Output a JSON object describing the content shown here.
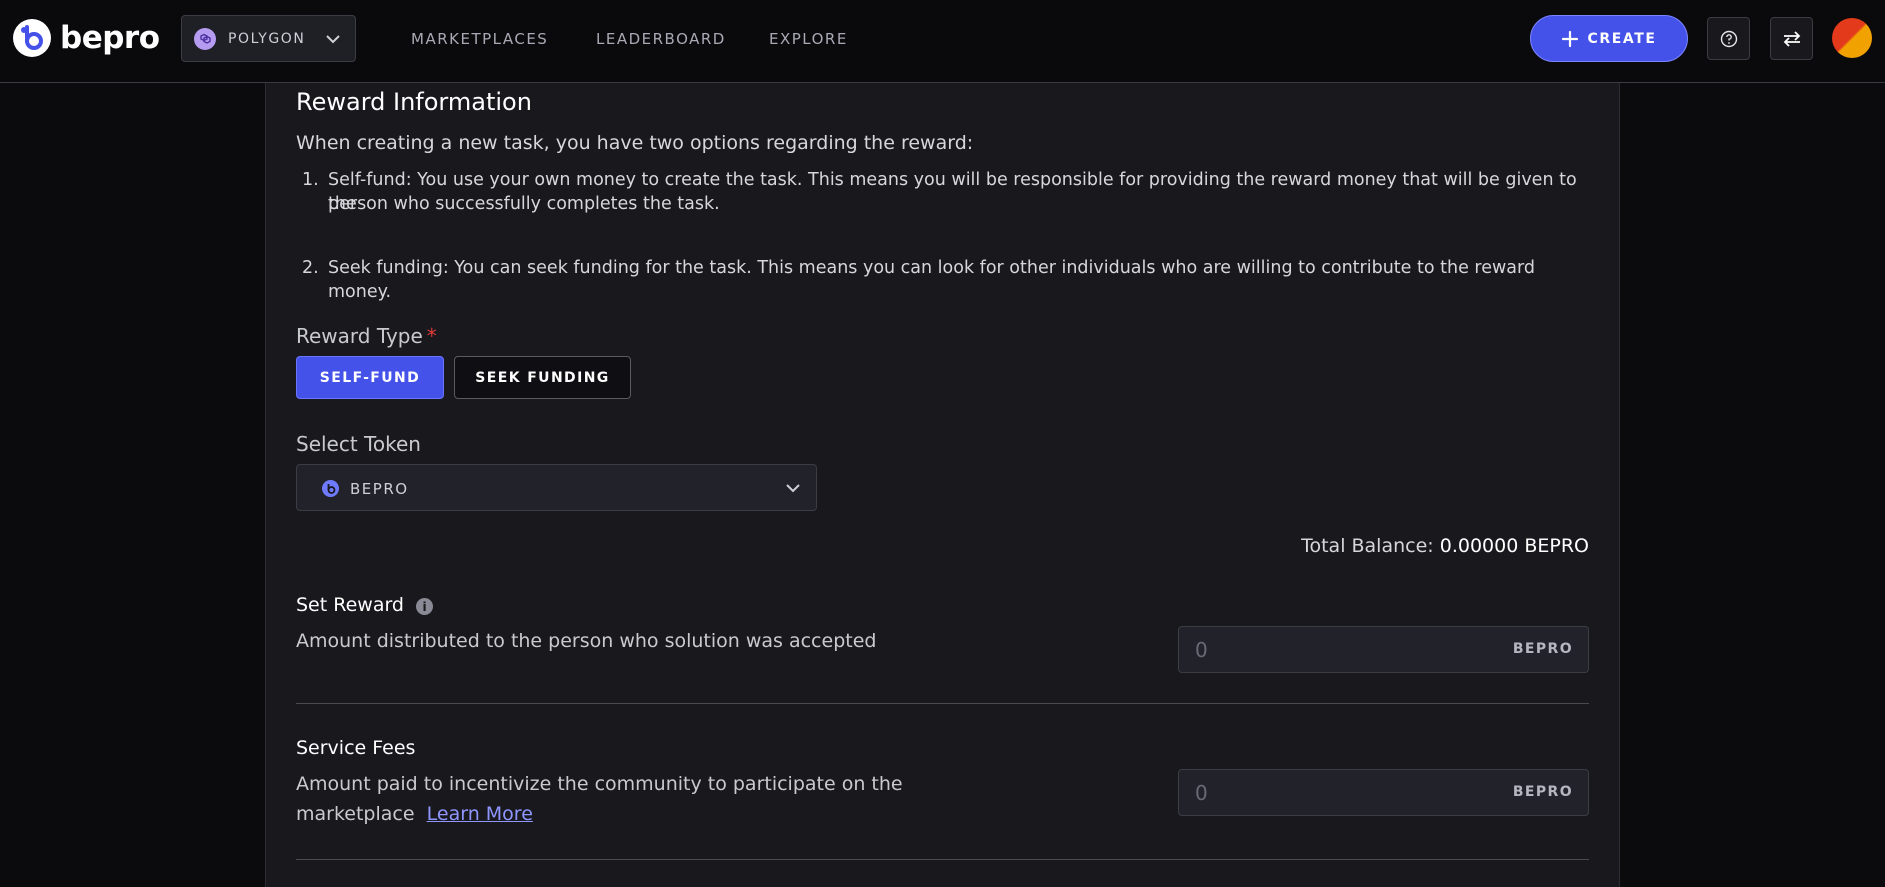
{
  "header": {
    "logo_text": "bepro",
    "network": {
      "label": "POLYGON",
      "icon": "polygon-icon"
    },
    "nav": [
      "MARKETPLACES",
      "LEADERBOARD",
      "EXPLORE"
    ],
    "create_label": "CREATE",
    "help_icon": "help-circle-icon",
    "swap_icon": "swap-arrows-icon",
    "accent_color": "#4452ea"
  },
  "reward": {
    "title": "Reward Information",
    "intro": "When creating a new task, you have two options regarding the reward:",
    "options": [
      {
        "num": "1.",
        "line1": "Self-fund: You use your own money to create the task. This means you will be responsible for providing the reward money that will be given to the",
        "line2": "person who successfully completes the task."
      },
      {
        "num": "2.",
        "line1": "Seek funding: You can seek funding for the task. This means you can look for other individuals who are willing to contribute to the reward money."
      }
    ],
    "type_label": "Reward Type",
    "required_mark": "*",
    "type_options": [
      "SELF-FUND",
      "SEEK FUNDING"
    ],
    "selected_type": "SELF-FUND",
    "token_label": "Select Token",
    "token_value": "BEPRO",
    "balance_label": "Total Balance:",
    "balance_value": "0.00000 BEPRO",
    "set_reward": {
      "title": "Set Reward",
      "desc": "Amount distributed to the person who solution was accepted",
      "placeholder": "0",
      "unit": "BEPRO"
    },
    "service_fees": {
      "title": "Service Fees",
      "desc_line1": "Amount paid to incentivize the community to participate on the",
      "desc_line2": "marketplace",
      "learn_more": "Learn More",
      "placeholder": "0",
      "unit": "BEPRO"
    }
  }
}
